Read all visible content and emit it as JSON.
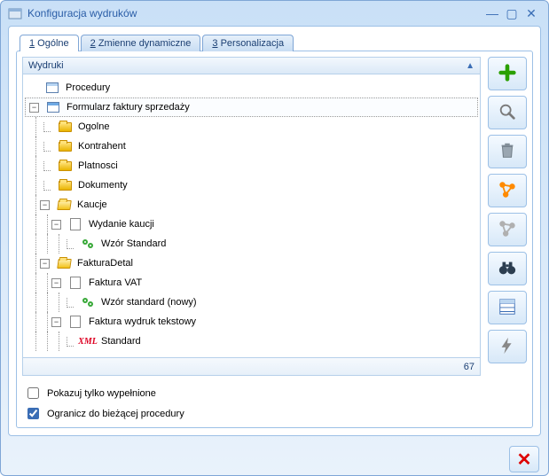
{
  "window": {
    "title": "Konfiguracja wydruków"
  },
  "tabs": [
    {
      "label": "Ogólne",
      "accel": "1",
      "active": true
    },
    {
      "label": "Zmienne dynamiczne",
      "accel": "2",
      "active": false
    },
    {
      "label": "Personalizacja",
      "accel": "3",
      "active": false
    }
  ],
  "tree_header": "Wydruki",
  "tree_count": "67",
  "tree": [
    {
      "depth": 0,
      "toggle": null,
      "icon": "window",
      "label": "Procedury",
      "name": "node-procedury"
    },
    {
      "depth": 0,
      "toggle": "-",
      "icon": "form",
      "label": "Formularz faktury sprzedaży",
      "name": "node-formularz",
      "selected": true
    },
    {
      "depth": 1,
      "toggle": null,
      "dot": true,
      "icon": "folder",
      "label": "Ogolne",
      "name": "node-ogolne"
    },
    {
      "depth": 1,
      "toggle": null,
      "dot": true,
      "icon": "folder",
      "label": "Kontrahent",
      "name": "node-kontrahent"
    },
    {
      "depth": 1,
      "toggle": null,
      "dot": true,
      "icon": "folder",
      "label": "Platnosci",
      "name": "node-platnosci"
    },
    {
      "depth": 1,
      "toggle": null,
      "dot": true,
      "icon": "folder",
      "label": "Dokumenty",
      "name": "node-dokumenty"
    },
    {
      "depth": 1,
      "toggle": "-",
      "icon": "folder-open",
      "label": "Kaucje",
      "name": "node-kaucje"
    },
    {
      "depth": 2,
      "toggle": "-",
      "icon": "page",
      "label": "Wydanie kaucji",
      "name": "node-wydanie-kaucji"
    },
    {
      "depth": 3,
      "toggle": null,
      "dot": true,
      "icon": "gears",
      "label": "Wzór Standard",
      "name": "node-wzor-standard"
    },
    {
      "depth": 1,
      "toggle": "-",
      "icon": "folder-open",
      "label": "FakturaDetal",
      "name": "node-fakturadetal"
    },
    {
      "depth": 2,
      "toggle": "-",
      "icon": "page",
      "label": "Faktura VAT",
      "name": "node-faktura-vat"
    },
    {
      "depth": 3,
      "toggle": null,
      "dot": true,
      "icon": "gears",
      "label": "Wzór standard (nowy)",
      "name": "node-wzor-standard-nowy"
    },
    {
      "depth": 2,
      "toggle": "-",
      "icon": "page",
      "label": "Faktura wydruk tekstowy",
      "name": "node-faktura-tekstowy"
    },
    {
      "depth": 3,
      "toggle": null,
      "dot": true,
      "icon": "xml",
      "label": "Standard",
      "name": "node-standard-xml"
    }
  ],
  "checks": {
    "show_filled": {
      "label": "Pokazuj tylko wypełnione",
      "checked": false
    },
    "limit_current": {
      "label": "Ogranicz do bieżącej procedury",
      "checked": true
    }
  },
  "toolbar": [
    {
      "name": "add-button",
      "icon": "plus"
    },
    {
      "name": "zoom-button",
      "icon": "magnifier"
    },
    {
      "name": "trash-button",
      "icon": "trash"
    },
    {
      "name": "connect-button",
      "icon": "nodes-orange"
    },
    {
      "name": "relations-button",
      "icon": "nodes-gray"
    },
    {
      "name": "binoculars-button",
      "icon": "binoculars"
    },
    {
      "name": "list-button",
      "icon": "list"
    },
    {
      "name": "lightning-button",
      "icon": "lightning"
    }
  ]
}
